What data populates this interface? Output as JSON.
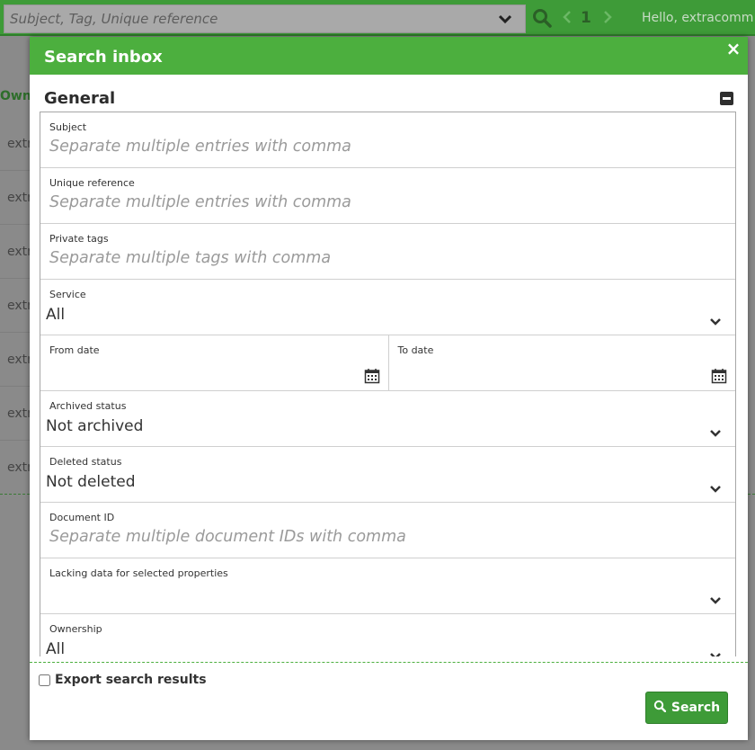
{
  "topbar": {
    "search_placeholder": "Subject, Tag, Unique reference",
    "page_number": "1",
    "greeting": "Hello, extracomm"
  },
  "background": {
    "owner_header": "Owne",
    "row_text": "extr"
  },
  "modal": {
    "title": "Search inbox",
    "close_label": "×",
    "section_title": "General",
    "fields": {
      "subject": {
        "label": "Subject",
        "placeholder": "Separate multiple entries with comma"
      },
      "unique_reference": {
        "label": "Unique reference",
        "placeholder": "Separate multiple entries with comma"
      },
      "private_tags": {
        "label": "Private tags",
        "placeholder": "Separate multiple tags with comma"
      },
      "service": {
        "label": "Service",
        "value": "All"
      },
      "from_date": {
        "label": "From date"
      },
      "to_date": {
        "label": "To date"
      },
      "archived_status": {
        "label": "Archived status",
        "value": "Not archived"
      },
      "deleted_status": {
        "label": "Deleted status",
        "value": "Not deleted"
      },
      "document_id": {
        "label": "Document ID",
        "placeholder": "Separate multiple document IDs with comma"
      },
      "lacking_data": {
        "label": "Lacking data for selected properties",
        "value": ""
      },
      "ownership": {
        "label": "Ownership",
        "value": "All"
      }
    },
    "export_label": "Export search results",
    "search_button": "Search"
  },
  "colors": {
    "brand_green": "#4caf3e",
    "dark_green": "#3e9b38"
  }
}
